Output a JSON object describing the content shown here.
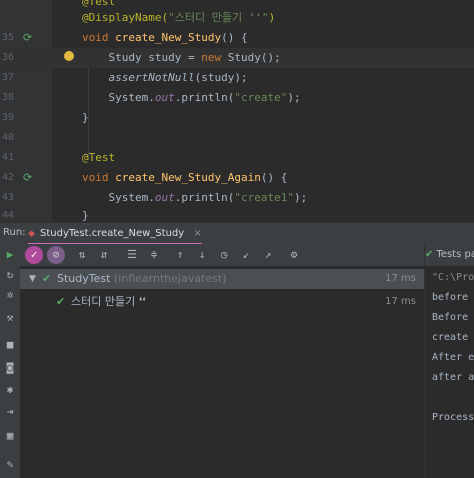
{
  "editor": {
    "lines": [
      {
        "num": "",
        "tokens": [
          {
            "t": "@Test",
            "c": "ann"
          }
        ]
      },
      {
        "num": "",
        "tokens": [
          {
            "t": "@DisplayName(",
            "c": "ann"
          },
          {
            "t": "\"스터디 만들기 ❛❛\"",
            "c": "str"
          },
          {
            "t": ")",
            "c": "ann"
          }
        ]
      },
      {
        "num": "35",
        "tokens": [
          {
            "t": "void ",
            "c": "kw"
          },
          {
            "t": "create_New_Study",
            "c": "fn"
          },
          {
            "t": "() {",
            "c": "cls"
          }
        ]
      },
      {
        "num": "36",
        "tokens": [
          {
            "t": "    Study ",
            "c": "cls"
          },
          {
            "t": "study",
            "c": "cls"
          },
          {
            "t": " = ",
            "c": "cls"
          },
          {
            "t": "new ",
            "c": "kw"
          },
          {
            "t": "Study();",
            "c": "cls"
          }
        ]
      },
      {
        "num": "37",
        "tokens": [
          {
            "t": "    ",
            "c": "cls"
          },
          {
            "t": "assertNotNull",
            "c": "sfn"
          },
          {
            "t": "(study);",
            "c": "cls"
          }
        ]
      },
      {
        "num": "38",
        "tokens": [
          {
            "t": "    System.",
            "c": "cls"
          },
          {
            "t": "out",
            "c": "it"
          },
          {
            "t": ".println(",
            "c": "cls"
          },
          {
            "t": "\"create\"",
            "c": "str"
          },
          {
            "t": ");",
            "c": "cls"
          }
        ]
      },
      {
        "num": "39",
        "tokens": [
          {
            "t": "}",
            "c": "cls"
          }
        ]
      },
      {
        "num": "40",
        "tokens": []
      },
      {
        "num": "41",
        "tokens": [
          {
            "t": "@Test",
            "c": "ann"
          }
        ]
      },
      {
        "num": "42",
        "tokens": [
          {
            "t": "void ",
            "c": "kw"
          },
          {
            "t": "create_New_Study_Again",
            "c": "fn"
          },
          {
            "t": "() {",
            "c": "cls"
          }
        ]
      },
      {
        "num": "43",
        "tokens": [
          {
            "t": "    System.",
            "c": "cls"
          },
          {
            "t": "out",
            "c": "it"
          },
          {
            "t": ".println(",
            "c": "cls"
          },
          {
            "t": "\"create1\"",
            "c": "str"
          },
          {
            "t": ");",
            "c": "cls"
          }
        ]
      },
      {
        "num": "44",
        "tokens": [
          {
            "t": "}",
            "c": "cls"
          }
        ]
      }
    ]
  },
  "run": {
    "label": "Run:",
    "tab_label": "StudyTest.create_New_Study",
    "close": "×"
  },
  "tree": {
    "root": {
      "name": "StudyTest",
      "pkg": "(inflearnthejavatest)",
      "time": "17 ms"
    },
    "child": {
      "name": "스터디 만들기 ❛❛",
      "time": "17 ms"
    }
  },
  "console": {
    "header": "Tests pa",
    "lines": [
      "\"C:\\Pro",
      "before",
      "Before",
      "create",
      "After e",
      "after a",
      "",
      "Process"
    ]
  }
}
